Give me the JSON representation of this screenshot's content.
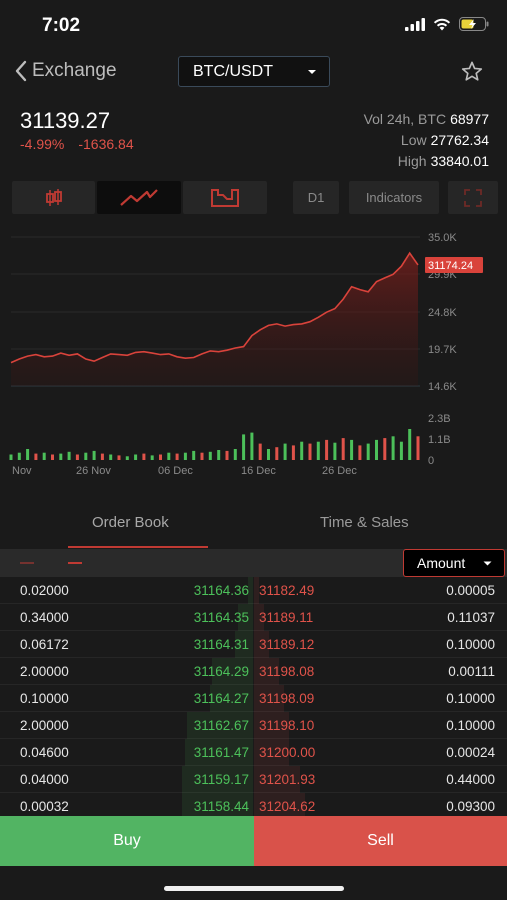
{
  "status": {
    "time": "7:02"
  },
  "nav": {
    "back_label": "Exchange",
    "pair": "BTC/USDT"
  },
  "ticker": {
    "price": "31139.27",
    "change_pct": "-4.99%",
    "change_abs": "-1636.84",
    "vol_label": "Vol 24h, BTC",
    "vol_value": "68977",
    "low_label": "Low",
    "low_value": "27762.34",
    "high_label": "High",
    "high_value": "33840.01"
  },
  "toolbar": {
    "interval": "D1",
    "indicators": "Indicators"
  },
  "chart": {
    "price_labels": [
      "35.0K",
      "29.9K",
      "24.8K",
      "19.7K",
      "14.6K"
    ],
    "current_price": "31174.24",
    "volume_labels": [
      "2.3B",
      "1.1B",
      "0"
    ],
    "x_labels": [
      "Nov",
      "26 Nov",
      "06 Dec",
      "16 Dec",
      "26 Dec"
    ],
    "colors": {
      "up": "#4cc05a",
      "down": "#e0534a",
      "line": "#d9433b"
    }
  },
  "chart_data": {
    "type": "line",
    "title": "",
    "price_series": [
      17800,
      18300,
      18700,
      18900,
      18600,
      18700,
      19100,
      18800,
      19000,
      18300,
      18000,
      18500,
      19000,
      18900,
      18800,
      19200,
      19300,
      19100,
      18900,
      19000,
      18600,
      18400,
      18500,
      19000,
      19400,
      19300,
      19500,
      19800,
      20000,
      21500,
      22300,
      22900,
      23100,
      22800,
      23000,
      23100,
      23400,
      24000,
      24700,
      25200,
      26500,
      28200,
      27800,
      27500,
      28900,
      29400,
      29900,
      31000,
      32800,
      31174
    ],
    "volume_series": [
      0.3,
      0.4,
      0.6,
      0.35,
      0.4,
      0.3,
      0.35,
      0.45,
      0.3,
      0.4,
      0.5,
      0.35,
      0.3,
      0.25,
      0.2,
      0.3,
      0.35,
      0.25,
      0.3,
      0.4,
      0.35,
      0.4,
      0.5,
      0.4,
      0.45,
      0.55,
      0.5,
      0.6,
      1.4,
      1.5,
      0.9,
      0.6,
      0.7,
      0.9,
      0.8,
      1.0,
      0.9,
      1.0,
      1.1,
      0.95,
      1.2,
      1.1,
      0.8,
      0.9,
      1.1,
      1.2,
      1.3,
      1.0,
      1.7,
      1.3
    ],
    "volume_up": [
      true,
      true,
      true,
      false,
      true,
      false,
      true,
      true,
      false,
      true,
      true,
      false,
      true,
      false,
      true,
      true,
      false,
      true,
      false,
      true,
      false,
      true,
      true,
      false,
      true,
      true,
      false,
      true,
      true,
      true,
      false,
      true,
      false,
      true,
      false,
      true,
      false,
      true,
      false,
      true,
      false,
      true,
      false,
      true,
      true,
      false,
      true,
      true,
      true,
      false
    ],
    "ylim": [
      14600,
      35000
    ],
    "volume_ylim": [
      0,
      2.3
    ]
  },
  "tabs": [
    "Order Book",
    "Time & Sales"
  ],
  "orderbook": {
    "amount_label": "Amount",
    "rows": [
      {
        "bid_qty": "0.02000",
        "bid_price": "31164.36",
        "ask_price": "31182.49",
        "ask_qty": "0.00005"
      },
      {
        "bid_qty": "0.34000",
        "bid_price": "31164.35",
        "ask_price": "31189.11",
        "ask_qty": "0.11037"
      },
      {
        "bid_qty": "0.06172",
        "bid_price": "31164.31",
        "ask_price": "31189.12",
        "ask_qty": "0.10000"
      },
      {
        "bid_qty": "2.00000",
        "bid_price": "31164.29",
        "ask_price": "31198.08",
        "ask_qty": "0.00111"
      },
      {
        "bid_qty": "0.10000",
        "bid_price": "31164.27",
        "ask_price": "31198.09",
        "ask_qty": "0.10000"
      },
      {
        "bid_qty": "2.00000",
        "bid_price": "31162.67",
        "ask_price": "31198.10",
        "ask_qty": "0.10000"
      },
      {
        "bid_qty": "0.04600",
        "bid_price": "31161.47",
        "ask_price": "31200.00",
        "ask_qty": "0.00024"
      },
      {
        "bid_qty": "0.04000",
        "bid_price": "31159.17",
        "ask_price": "31201.93",
        "ask_qty": "0.44000"
      },
      {
        "bid_qty": "0.00032",
        "bid_price": "31158.44",
        "ask_price": "31204.62",
        "ask_qty": "0.09300"
      }
    ],
    "bid_depth": [
      0.01,
      0.03,
      0.035,
      0.08,
      0.085,
      0.13,
      0.135,
      0.14,
      0.14
    ],
    "ask_depth": [
      0.01,
      0.02,
      0.03,
      0.05,
      0.06,
      0.07,
      0.07,
      0.09,
      0.1
    ]
  },
  "actions": {
    "buy": "Buy",
    "sell": "Sell"
  }
}
